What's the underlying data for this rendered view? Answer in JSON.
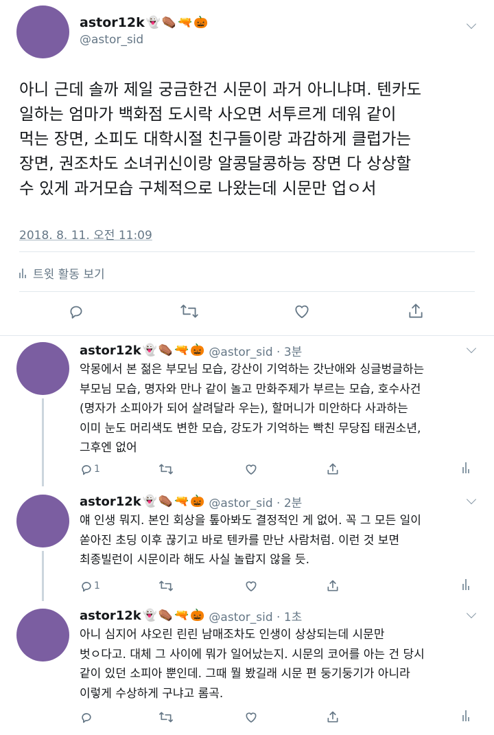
{
  "main_tweet": {
    "display_name": "astor12k",
    "emojis": [
      "👻",
      "⚰️",
      "🔫",
      "🎃"
    ],
    "handle": "@astor_sid",
    "text": "아니 근데 솔까 제일 궁금한건 시문이 과거 아니냐며. 텐카도\n일하는 엄마가 백화점 도시락 사오면 서투르게 데워 같이\n먹는 장면, 소피도 대학시절 친구들이랑 과감하게 클럽가는\n장면, 권조차도 소녀귀신이랑 알콩달콩하능 장면 다 상상할\n수 있게 과거모습 구체적으로 나왔는데 시문만 업ㅇ서",
    "timestamp": "2018. 8. 11. 오전 11:09",
    "activity_label": "트윗 활동 보기"
  },
  "replies": [
    {
      "display_name": "astor12k",
      "emojis": [
        "👻",
        "⚰️",
        "🔫",
        "🎃"
      ],
      "handle_time": "@astor_sid · 3분",
      "text": "악몽에서 본 젊은 부모님 모습, 강산이 기억하는 갓난애와 싱글벙글하는\n부모님 모습, 명자와 만나 같이 놀고 만화주제가 부르는 모습, 호수사건\n(명자가 소피아가 되어 살려달라 우는), 할머니가 미안하다 사과하는\n이미 눈도 머리색도 변한 모습, 강도가 기억하는 빡친 무당집 태권소년,\n그후엔 없어",
      "reply_count": "1"
    },
    {
      "display_name": "astor12k",
      "emojis": [
        "👻",
        "⚰️",
        "🔫",
        "🎃"
      ],
      "handle_time": "@astor_sid · 2분",
      "text": "얘 인생 뭐지. 본인 회상을 톺아봐도 결정적인 게 없어. 꼭 그 모든 일이\n쏟아진 초딩 이후 끊기고 바로 텐카를 만난 사람처럼. 이런 것 보면\n최종빌런이 시문이라 해도 사실 놀랍지 않을 듯.",
      "reply_count": "1"
    },
    {
      "display_name": "astor12k",
      "emojis": [
        "👻",
        "⚰️",
        "🔫",
        "🎃"
      ],
      "handle_time": "@astor_sid · 1초",
      "text": "아니 심지어 샤오린 린린 남매조차도 인생이 상상되는데 시문만\n벗ㅇ다고. 대체 그 사이에 뭐가 일어났는지. 시문의 코어를 아는 건 당시\n같이 있던 소피아 뿐인데. 그때 뭘 봤길래 시문 편 둥기둥기가 아니라\n이렇게 수상하게 구냐고 롬곡.",
      "reply_count": ""
    }
  ],
  "colors": {
    "avatar": "#7b5ea1",
    "icon": "#657786",
    "divider": "#e1e8ed",
    "text": "#14171a",
    "secondary": "#657786"
  }
}
